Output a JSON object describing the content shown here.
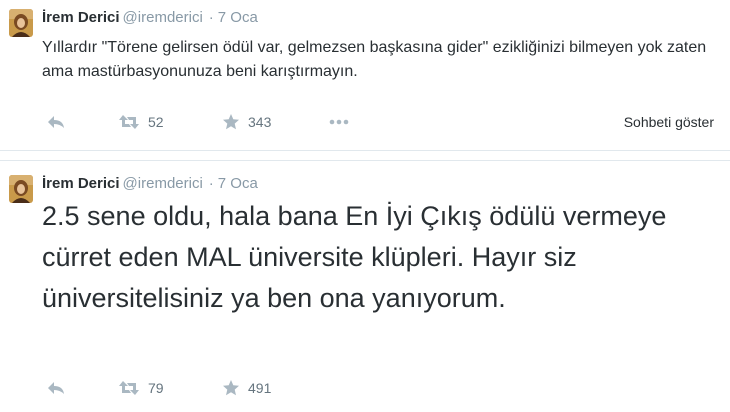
{
  "tweets": [
    {
      "fullname": "İrem Derici",
      "username": "@iremderici",
      "separator": "·",
      "time": "7 Oca",
      "text": "Yıllardır \"Törene gelirsen ödül var, gelmezsen başkasına gider\" ezikliğinizi bilmeyen yok zaten ama mastürbasyonunuza beni karıştırmayın.",
      "retweets": "52",
      "favorites": "343",
      "show_conversation": "Sohbeti göster"
    },
    {
      "fullname": "İrem Derici",
      "username": "@iremderici",
      "separator": "·",
      "time": "7 Oca",
      "text": "2.5 sene oldu, hala bana En İyi Çıkış ödülü vermeye cürret eden MAL üniversite klüpleri. Hayır siz üniversitelisiniz ya ben ona yanıyorum.",
      "retweets": "79",
      "favorites": "491"
    }
  ],
  "icons": {
    "reply": "reply-icon",
    "retweet": "retweet-icon",
    "favorite": "star-icon",
    "more": "more-dots-icon"
  },
  "colors": {
    "text": "#292f33",
    "muted": "#8899a6",
    "count": "#66757f",
    "divider": "#e1e8ed",
    "icon": "#aab8c2"
  }
}
